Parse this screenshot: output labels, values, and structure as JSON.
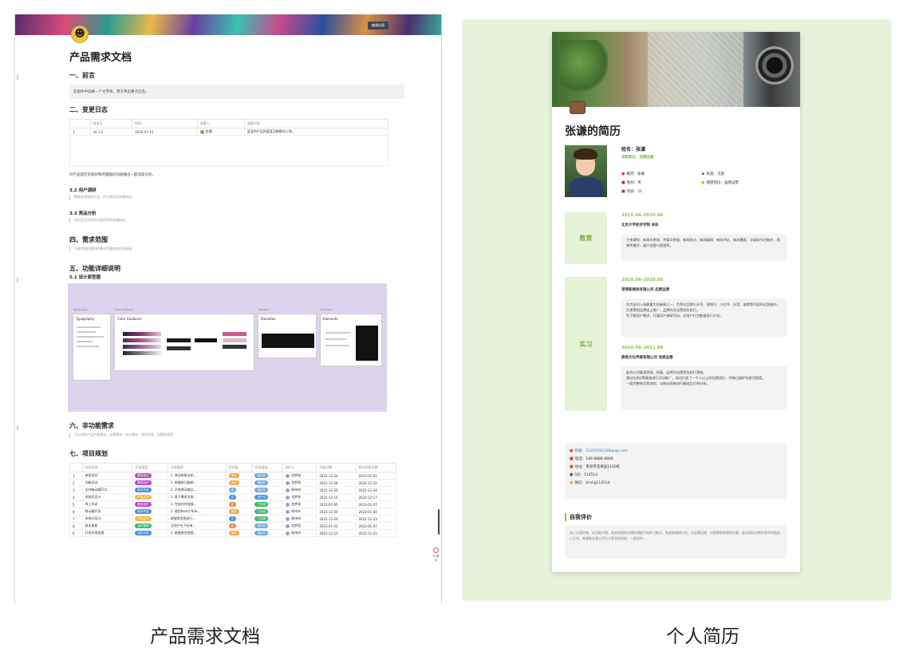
{
  "doc": {
    "cover_button": "编辑封面",
    "title": "产品需求文档",
    "preface_heading": "一、前言",
    "preface_callout": "在组件中选择一个文字块，用于突出重点信息。",
    "changelog_heading": "二、变更日志",
    "changelog_columns": [
      "",
      "版本号",
      "时间",
      "变更人",
      "变更内容"
    ],
    "changelog_rows": [
      {
        "idx": "1",
        "version": "v0.1.2",
        "date": "2022-07-15",
        "person": "张瑾",
        "content": "某某的产品的某某功能模块上线。"
      }
    ],
    "analysis_para": "对产品现在的现状和所面临的问题做出一般深度分析。",
    "research_heading": "3.2 用户调研",
    "research_quote": "需要说明调研方法，用卡概况及关键结论。",
    "competitor_heading": "3.3 竞品分析",
    "competitor_quote": "列出竞品对比的主要信息和关键结论。",
    "scope_heading": "四、需求范围",
    "scope_quote": "可使用我们提供的需求范围描述信息表格。",
    "features_heading": "五、功能详细说明",
    "design_heading": "5.1 设计原型图",
    "design_boards": [
      {
        "tag": "Typography",
        "title": "Typography"
      },
      {
        "tag": "Color Guidance",
        "title": "Color Guidance"
      },
      {
        "tag": "Elevation",
        "title": "Elevation"
      },
      {
        "tag": "Elements",
        "title": "Elements"
      }
    ],
    "nonfunc_heading": "六、非功能需求",
    "nonfunc_quote": "可以列举产品性能需求，运营需求，安全需求，使用环境，问题处理等",
    "plan_heading": "七、项目规划",
    "plan_columns": [
      "",
      "任务名称",
      "任务类型",
      "任务描述",
      "优先级",
      "任务进度",
      "执行人",
      "开始日期",
      "预计完成日期"
    ],
    "plan_rows": [
      {
        "idx": "1",
        "name": "单组测试",
        "type": "需求测试",
        "desc": "1. 测试新版本机…",
        "prio": "紧急",
        "status": "规划中",
        "owner": "龙梦瑶",
        "start": "2022-12-30",
        "end": "2023-01-01"
      },
      {
        "idx": "2",
        "name": "功能测试",
        "type": "需求测试",
        "desc": "1. 根据新功能新…",
        "prio": "紧急",
        "status": "规划中",
        "owner": "龙梦瑶",
        "start": "2022-12-28",
        "end": "2022-12-31"
      },
      {
        "idx": "3",
        "name": "支持移动端Tint…",
        "type": "软件开发",
        "desc": "1. 开发移动端交…",
        "prio": "低",
        "status": "规划中",
        "owner": "周伟伟",
        "start": "2022-12-20",
        "end": "2022-12-24"
      },
      {
        "idx": "4",
        "name": "系统总设计",
        "type": "产品设计",
        "desc": "1. 基于需求文档…",
        "prio": "中",
        "status": "进行中",
        "owner": "龙梦瑶",
        "start": "2022-12-15",
        "end": "2022-12-17"
      },
      {
        "idx": "5",
        "name": "线上测试",
        "type": "需求测试",
        "desc": "1. 完成内外链接…",
        "prio": "高",
        "status": "已完成",
        "owner": "龙梦瑶",
        "start": "2023-01-05",
        "end": "2023-01-07"
      },
      {
        "idx": "6",
        "name": "移动端开发",
        "type": "软件开发",
        "desc": "1. 使用React Nati…",
        "prio": "紧急",
        "status": "已完成",
        "owner": "周伟伟",
        "start": "2022-12-30",
        "end": "2023-01-04"
      },
      {
        "idx": "7",
        "name": "系统UI设计",
        "type": "产品设计",
        "desc": "根据原型图进行…",
        "prio": "中",
        "status": "已完成",
        "owner": "周伟伟",
        "start": "2022-12-20",
        "end": "2022-12-23"
      },
      {
        "idx": "8",
        "name": "版本更新",
        "type": "版本管理",
        "desc": "当用户在下拉有…",
        "prio": "高",
        "status": "规划中",
        "owner": "龙梦瑶",
        "start": "2023-01-02",
        "end": "2023-01-07"
      },
      {
        "idx": "9",
        "name": "开发环境搭建",
        "type": "软件开发",
        "desc": "1. 根据原型图搭…",
        "prio": "紧急",
        "status": "规划中",
        "owner": "周伟伟",
        "start": "2022-12-23",
        "end": "2022-12-25"
      }
    ],
    "ai_label": "AI 助手"
  },
  "resume": {
    "title": "张谦的简历",
    "name_line": "姓名：张谦",
    "job_line": "求职职位：品牌运营",
    "info": [
      [
        "籍贯：张谦",
        "民族：汉族"
      ],
      [
        "性别：男",
        "期望岗位：品牌运营"
      ],
      [
        "年龄：21",
        ""
      ]
    ],
    "education_label": "教育",
    "edu_period": "2016.06-2020.06",
    "edu_org": "北京大学经济学院 本科",
    "edu_text": "主修课程：新闻学原理、传媒学原理、新闻采访、新闻编辑、新闻评论、新闻摄影、全媒体节目制作、视频传播学、媒介经营与管理等。",
    "intern_label": "实习",
    "job1_period": "2020.06-2020.09",
    "job1_org": "港港新媒体有限公司 品牌运营",
    "job1_text": [
      "作为该司入选最重大的新闻之一，负责对品牌公众号、视频号、小红书、抖音、微博等内容的运营维护。",
      "负责策划品牌线上推广、品牌的活动策划及执行。",
      "为了解用户需求，开展用户调研活动，对用户行为数据进行分析。"
    ],
    "job2_period": "2020.06-2021.09",
    "job2_org": "鼎视文化传媒有限公司 电商运营",
    "job2_text": [
      "配合公司渠道营销，拓展、品牌活动策划及执行落地。",
      "通过在B站等渠道进行活动推广，成功打造了一千人以上的社群团队，并每日维护社群活跃度。",
      "一套完整的运营流程，对粉丝画像进行精准定位和分析。"
    ],
    "contact": [
      {
        "icon": "mail-icon",
        "text": "邮箱：12105192108@qq.com",
        "link": true
      },
      {
        "icon": "phone-icon",
        "text": "电话：188 8888 8888",
        "link": false
      },
      {
        "icon": "home-icon",
        "text": "住址：贵阳市花果园1100栋",
        "link": false
      },
      {
        "icon": "qq-icon",
        "text": "QQ：114514",
        "link": false
      },
      {
        "icon": "wechat-icon",
        "text": "微信：zhang114514",
        "link": false
      }
    ],
    "eval_title": "自我评价",
    "eval_text": "本人乐观开朗、抗压能力强，具有较强的沟通协调能力和学习能力，热爱新媒体行业，对品牌运营、内容策划有独到见解，能迅速适应新环境并积极投入工作，希望能在贵公司与大家共同成长、一起进步。"
  },
  "captions": {
    "left": "产品需求文档",
    "right": "个人简历"
  },
  "colors": {
    "accent_green": "#8bc34a",
    "resume_bg": "#e6f3d9",
    "design_bg": "#ddd3ec"
  }
}
